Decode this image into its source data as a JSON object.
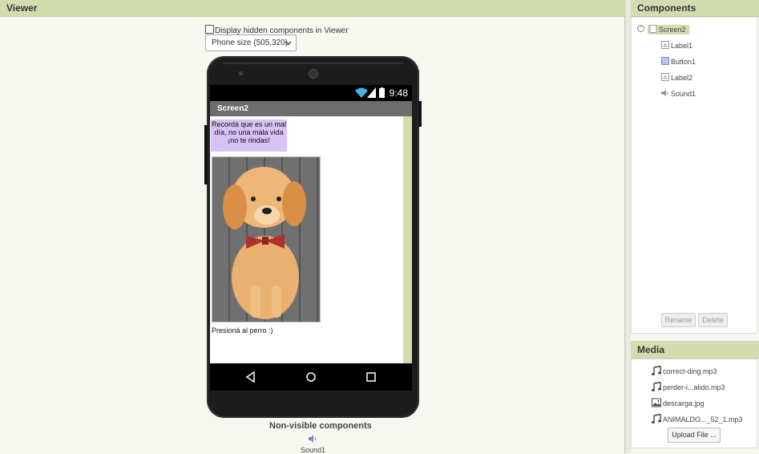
{
  "viewer": {
    "header": "Viewer",
    "display_hidden_label": "Display hidden components in Viewer",
    "phone_size_select": "Phone size (505,320)",
    "nonvisible_title": "Non-visible components",
    "nonvisible_items": [
      {
        "label": "Sound1",
        "icon": "speaker-icon"
      }
    ]
  },
  "phone": {
    "status_time": "9:48",
    "screen_title": "Screen2",
    "label1_text": "Recordá que es un mal día, no una mala vida ¡no te rindas!",
    "button1_image": "descarga.jpg",
    "label2_text": "Presioná al perro :)",
    "colors": {
      "label1_bg": "#d7c2f6",
      "title_bar": "#6d6d6d",
      "scrollbar": "#d2dcaf"
    }
  },
  "components": {
    "header": "Components",
    "tree": [
      {
        "label": "Screen2",
        "icon": "screen-icon",
        "selected": true
      },
      {
        "label": "Label1",
        "icon": "label-icon"
      },
      {
        "label": "Button1",
        "icon": "button-icon"
      },
      {
        "label": "Label2",
        "icon": "label-icon"
      },
      {
        "label": "Sound1",
        "icon": "speaker-icon"
      }
    ],
    "rename_label": "Rename",
    "delete_label": "Delete"
  },
  "media": {
    "header": "Media",
    "items": [
      {
        "label": "correct-ding.mp3",
        "icon": "music-note-icon"
      },
      {
        "label": "perder-i...alido.mp3",
        "icon": "music-note-icon"
      },
      {
        "label": "descarga.jpg",
        "icon": "image-icon"
      },
      {
        "label": "ANIMALDO..._52_1.mp3",
        "icon": "music-note-icon"
      }
    ],
    "upload_label": "Upload File ..."
  },
  "theme": {
    "header_bg": "#d2dcaf",
    "page_bg": "#f7f7f1"
  }
}
